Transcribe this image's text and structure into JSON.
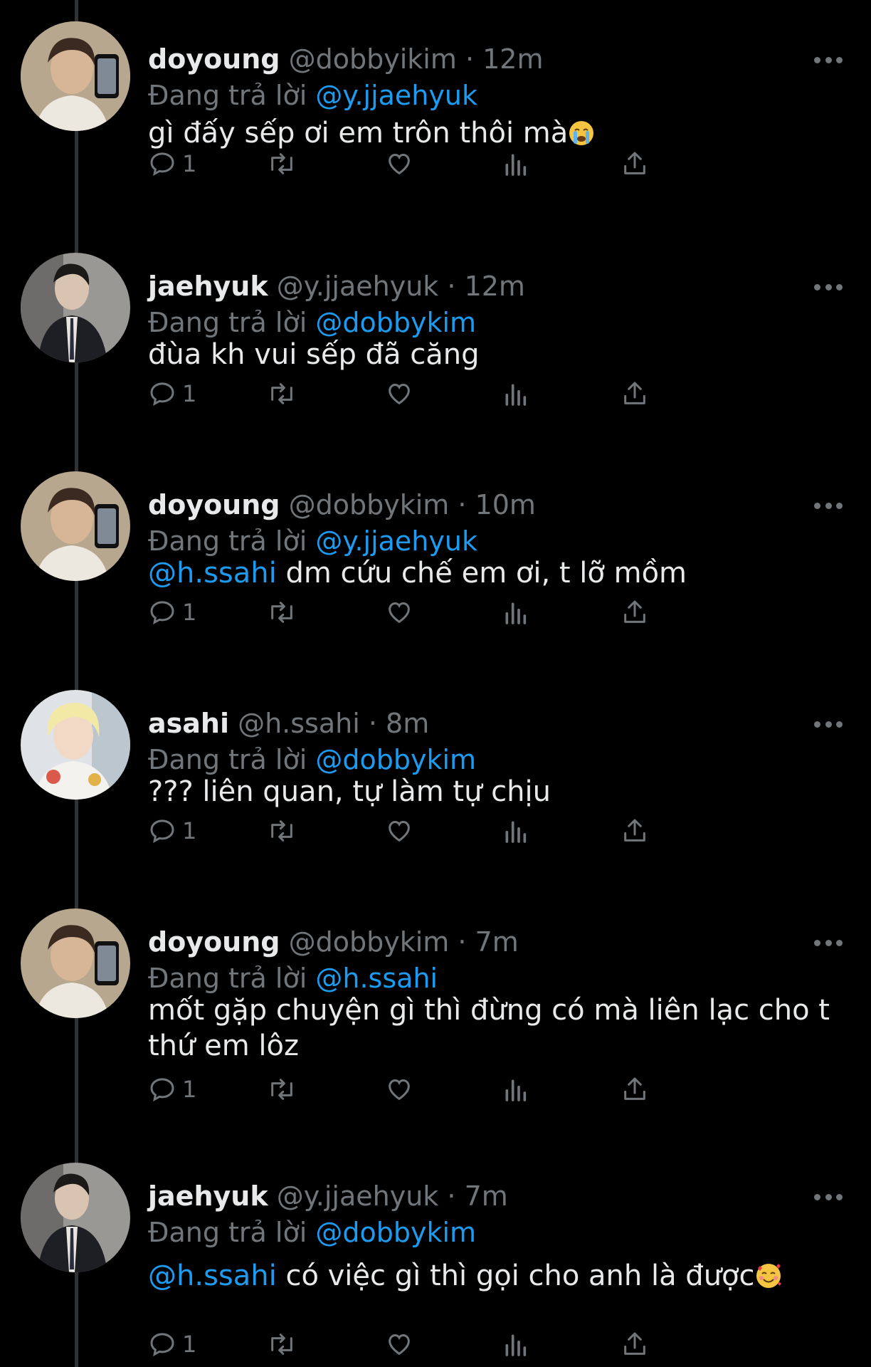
{
  "colors": {
    "background": "#000000",
    "text": "#e7e9ea",
    "muted": "#71767b",
    "link": "#1d9bf0",
    "thread_line": "#2f3336"
  },
  "reply_prefix": "Đang trả lời",
  "tweets": [
    {
      "name": "doyoung",
      "handle": "@dobbyikim",
      "time": "12m",
      "reply_to": "@y.jjaehyuk",
      "text": "gì đấy sếp ơi em trôn thôi mà",
      "emoji": "loudly-crying-face",
      "reply_count": "1",
      "avatar": "doyoung-avatar"
    },
    {
      "name": "jaehyuk",
      "handle": "@y.jjaehyuk",
      "time": "12m",
      "reply_to": "@dobbykim",
      "text": "đùa kh vui sếp đã căng",
      "reply_count": "1",
      "avatar": "jaehyuk-avatar"
    },
    {
      "name": "doyoung",
      "handle": "@dobbykim",
      "time": "10m",
      "reply_to": "@y.jjaehyuk",
      "mention": "@h.ssahi",
      "text": " dm cứu chế em ơi, t lỡ mồm",
      "reply_count": "1",
      "avatar": "doyoung-avatar"
    },
    {
      "name": "asahi",
      "handle": "@h.ssahi",
      "time": "8m",
      "reply_to": "@dobbykim",
      "text": "??? liên quan, tự làm tự chịu",
      "reply_count": "1",
      "avatar": "asahi-avatar"
    },
    {
      "name": "doyoung",
      "handle": "@dobbykim",
      "time": "7m",
      "reply_to": "@h.ssahi",
      "text": "mốt gặp chuyện gì thì đừng có mà liên lạc cho t\nthứ em lôz",
      "reply_count": "1",
      "avatar": "doyoung-avatar"
    },
    {
      "name": "jaehyuk",
      "handle": "@y.jjaehyuk",
      "time": "7m",
      "reply_to": "@dobbykim",
      "mention": "@h.ssahi",
      "text": " có việc gì thì gọi cho anh là được",
      "emoji": "smiling-face-with-hearts",
      "reply_count": "1",
      "avatar": "jaehyuk-avatar"
    }
  ]
}
